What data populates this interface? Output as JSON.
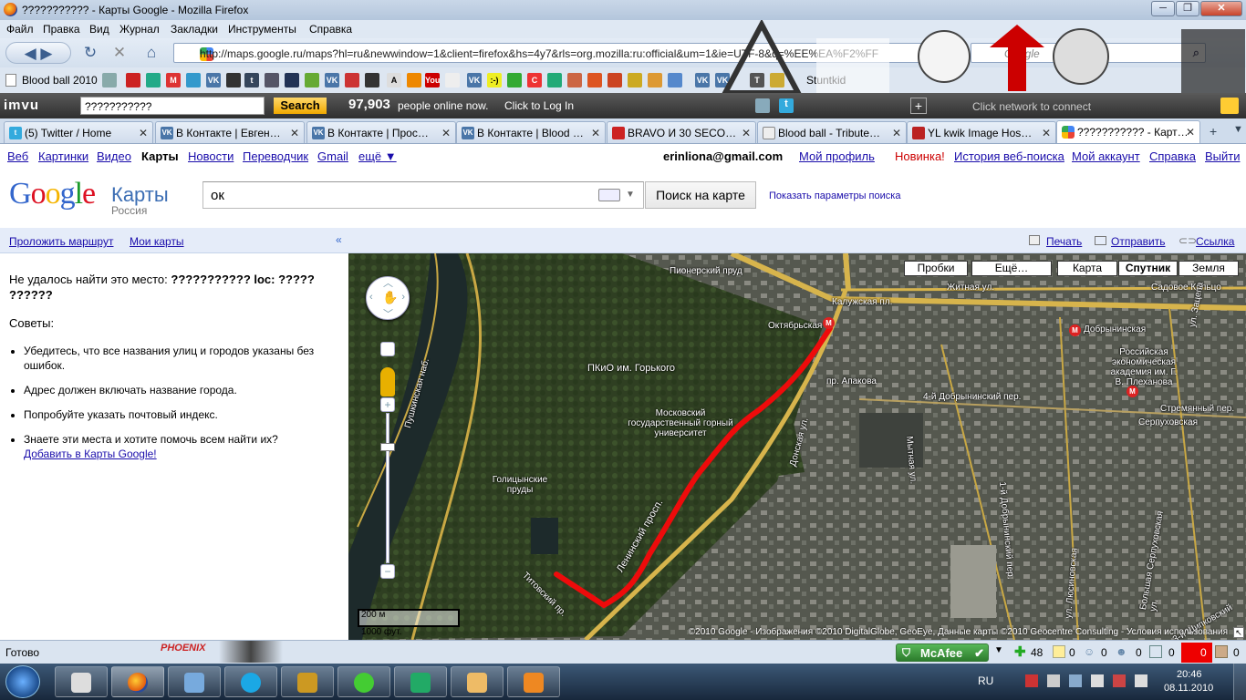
{
  "window": {
    "title": "??????????? - Карты Google - Mozilla Firefox"
  },
  "menu": [
    "Файл",
    "Правка",
    "Вид",
    "Журнал",
    "Закладки",
    "Инструменты",
    "Справка"
  ],
  "nav": {
    "url": "http://maps.google.ru/maps?hl=ru&newwindow=1&client=firefox&hs=4y7&rls=org.mozilla:ru:official&um=1&ie=UTF-8&q=%EE%EA%F2%FF",
    "search_placeholder": "Google"
  },
  "bookmarks": {
    "first": "Blood ball 2010",
    "last": "Stuntkid"
  },
  "imvu": {
    "logo": "imvu",
    "input": "???????????",
    "search": "Search",
    "count": "97,903",
    "online": "people online now.",
    "login": "Click to Log In",
    "network": "Click network to connect"
  },
  "tabs": [
    "(5) Twitter / Home",
    "В Контакте | Евген…",
    "В Контакте | Прос…",
    "В Контакте | Blood …",
    "BRAVO И 30 SECO…",
    "Blood ball - Tribute…",
    "YL kwik Image Hos…",
    "??????????? - Карт…"
  ],
  "gnav": {
    "links": [
      "Веб",
      "Картинки",
      "Видео",
      "Карты",
      "Новости",
      "Переводчик",
      "Gmail",
      "ещё ▼"
    ],
    "email": "erinliona@gmail.com",
    "right": [
      "Мой профиль",
      "Новинка!",
      "История веб-поиска",
      "Мой аккаунт",
      "Справка",
      "Выйти"
    ]
  },
  "gsearch": {
    "logo_sub": "Карты",
    "region": "Россия",
    "query": "ок",
    "button": "Поиск на карте",
    "options": "Показать параметры поиска"
  },
  "left": {
    "route": "Проложить маршрут",
    "mymaps": "Мои карты",
    "notfound": "Не удалось найти это место:",
    "notfound_q": "??????????? loc: ????? ??????",
    "tips_title": "Советы:",
    "tips": [
      "Убедитесь, что все названия улиц и городов указаны без ошибок.",
      "Адрес должен включать название города.",
      "Попробуйте указать почтовый индекс.",
      "Знаете эти места и хотите помочь всем найти их?"
    ],
    "add_link": "Добавить в Карты Google!"
  },
  "maphead": {
    "print": "Печать",
    "send": "Отправить",
    "link": "Ссылка"
  },
  "mapbtns": [
    "Пробки",
    "Ещё…",
    "Карта",
    "Спутник",
    "Земля"
  ],
  "maplabels": [
    "Пионерский пруд",
    "ПКиО им. Горького",
    "Московский государственный горный университет",
    "Голицынские пруды",
    "Октябрьская",
    "Калужская пл.",
    "Житная ул.",
    "Садовое Кольцо",
    "Добрынинская",
    "Российская экономическая академия им. Г. В. Плеханова",
    "Серпуховская",
    "Стремянный пер.",
    "пр. Апакова",
    "4-й Добрынинский пер.",
    "1-й Добрынинский пер.",
    "Мытная ул.",
    "Донская ул.",
    "ул. Зацепа",
    "Пушкинская наб.",
    "Ленинский просп.",
    "Титовский пр.",
    "Большая Серпуховская ул.",
    "ул. Люсиновская",
    "3-й Щипковский пер."
  ],
  "scale": {
    "m": "200 м",
    "ft": "1000 фут."
  },
  "copyright": "©2010 Google - Изображения ©2010 DigitalGlobe, GeoEye, Данные карты ©2010 Geocentre Consulting - Условия использования",
  "status": {
    "text": "Готово",
    "phoenix": "PHOENIX",
    "mcafee": "McAfee",
    "n48": "48",
    "z": "0"
  },
  "clock": {
    "lang": "RU",
    "time": "20:46",
    "date": "08.11.2010"
  }
}
